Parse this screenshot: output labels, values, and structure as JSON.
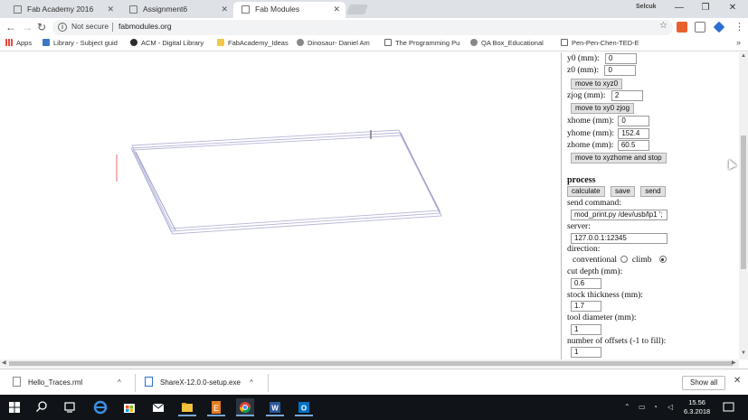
{
  "browser": {
    "tabs": [
      {
        "title": "Fab Academy 2016",
        "active": false
      },
      {
        "title": "Assignment6",
        "active": false
      },
      {
        "title": "Fab Modules",
        "active": true
      }
    ],
    "profile_name": "Selcuk",
    "security_label": "Not secure",
    "url": "fabmodules.org"
  },
  "bookmarks": {
    "apps_label": "Apps",
    "items": [
      {
        "label": "Library - Subject guid",
        "color": "#3b78c4"
      },
      {
        "label": "ACM - Digital Library",
        "color": "#2e2e2e"
      },
      {
        "label": "FabAcademy_Ideas",
        "color": "#f2c84b"
      },
      {
        "label": "Dinosaur- Daniel Am",
        "color": "#d8d8d8"
      },
      {
        "label": "The Programming Pu",
        "color": "#ffffff"
      },
      {
        "label": "QA Box_Educational",
        "color": "#d8d8d8"
      },
      {
        "label": "Pen-Pen-Chen-TED-E",
        "color": "#ffffff"
      }
    ]
  },
  "panel": {
    "y0_label": "y0 (mm):",
    "y0_value": "0",
    "z0_label": "z0 (mm):",
    "z0_value": "0",
    "move_xyz0_label": "move to xyz0",
    "zjog_label": "zjog (mm):",
    "zjog_value": "2",
    "move_xy0_zjog_label": "move to xy0 zjog",
    "xhome_label": "xhome (mm):",
    "xhome_value": "0",
    "yhome_label": "yhome (mm):",
    "yhome_value": "152.4",
    "zhome_label": "zhome (mm):",
    "zhome_value": "60.5",
    "move_home_label": "move to xyzhome and stop",
    "process_heading": "process",
    "calculate_label": "calculate",
    "save_label": "save",
    "send_label": "send",
    "send_command_label": "send command:",
    "send_command_value": "mod_print.py /dev/usb/lp1 ';",
    "server_label": "server:",
    "server_value": "127.0.0.1:12345",
    "direction_label": "direction:",
    "conventional_label": "conventional",
    "climb_label": "climb",
    "direction_selected": "climb",
    "cut_depth_label": "cut depth (mm):",
    "cut_depth_value": "0.6",
    "stock_thickness_label": "stock thickness (mm):",
    "stock_thickness_value": "1.7",
    "tool_diameter_label": "tool diameter (mm):",
    "tool_diameter_value": "1",
    "offsets_label": "number of offsets (-1 to fill):",
    "offsets_value": "1"
  },
  "downloads": {
    "items": [
      {
        "name": "Hello_Traces.rml"
      },
      {
        "name": "ShareX-12.0.0-setup.exe"
      }
    ],
    "show_all_label": "Show all"
  },
  "taskbar": {
    "time": "15.56",
    "date": "6.3.2018"
  }
}
